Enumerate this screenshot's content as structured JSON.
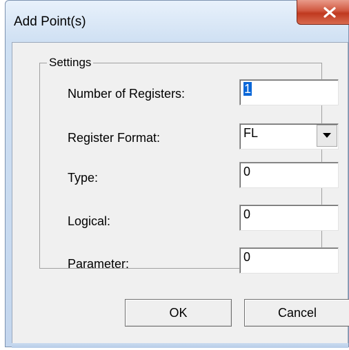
{
  "window": {
    "title": "Add Point(s)"
  },
  "settings": {
    "group_label": "Settings",
    "number_of_registers": {
      "label": "Number of Registers:",
      "value": "1"
    },
    "register_format": {
      "label": "Register Format:",
      "value": "FL"
    },
    "type": {
      "label": "Type:",
      "value": "0"
    },
    "logical": {
      "label": "Logical:",
      "value": "0"
    },
    "parameter": {
      "label": "Parameter:",
      "value": "0"
    }
  },
  "buttons": {
    "ok": "OK",
    "cancel": "Cancel"
  },
  "icons": {
    "close": "close-icon",
    "dropdown": "chevron-down-icon"
  },
  "colors": {
    "selection": "#0a67d8",
    "close_button": "#c0391f",
    "dialog_bg": "#f0f0f0"
  }
}
